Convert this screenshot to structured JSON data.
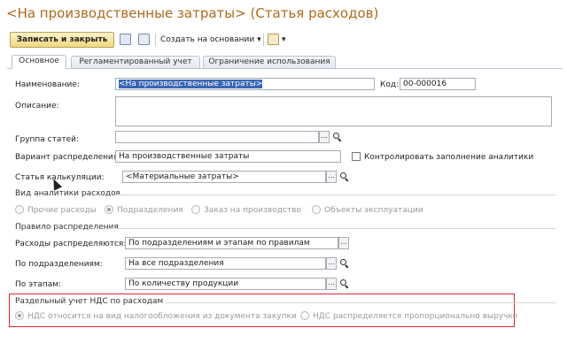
{
  "window": {
    "title": "<На производственные затраты> (Статья расходов)"
  },
  "toolbar": {
    "save_close_label": "Записать и закрыть",
    "create_basis_label": "Создать на основании"
  },
  "tabs": [
    {
      "label": "Основное"
    },
    {
      "label": "Регламентированный учет"
    },
    {
      "label": "Ограничение использования"
    }
  ],
  "form": {
    "name_label": "Наименование:",
    "name_value": "<На производственные затраты>",
    "code_label": "Код:",
    "code_value": "00-000016",
    "description_label": "Описание:",
    "description_value": "",
    "group_label": "Группа статей:",
    "group_value": "",
    "distribution_label": "Вариант распределения:",
    "distribution_value": "На производственные затраты",
    "control_analytics_label": "Контролировать заполнение аналитики",
    "calc_item_label": "Статья калькуляции:",
    "calc_item_value": "<Материальные затраты>"
  },
  "analytics": {
    "section_title": "Вид аналитики расходов",
    "options": [
      "Прочие расходы",
      "Подразделения",
      "Заказ на производство",
      "Объекты эксплуатации"
    ]
  },
  "rule": {
    "section_title": "Правило распределения",
    "expenses_label": "Расходы распределяются:",
    "expenses_value": "По подразделениям и этапам по правилам",
    "by_dept_label": "По подразделениям:",
    "by_dept_value": "На все подразделения",
    "by_stage_label": "По этапам:",
    "by_stage_value": "По количеству продукции"
  },
  "vat": {
    "section_title": "Раздельный учет НДС по расходам",
    "option_1": "НДС относится на вид налогообложения из документа закупки",
    "option_2": "НДС распределяется пропорционально выручке"
  },
  "colors": {
    "title_color": "#b0681a",
    "highlight_border": "#d9282f",
    "selection": "#3a66b5"
  }
}
